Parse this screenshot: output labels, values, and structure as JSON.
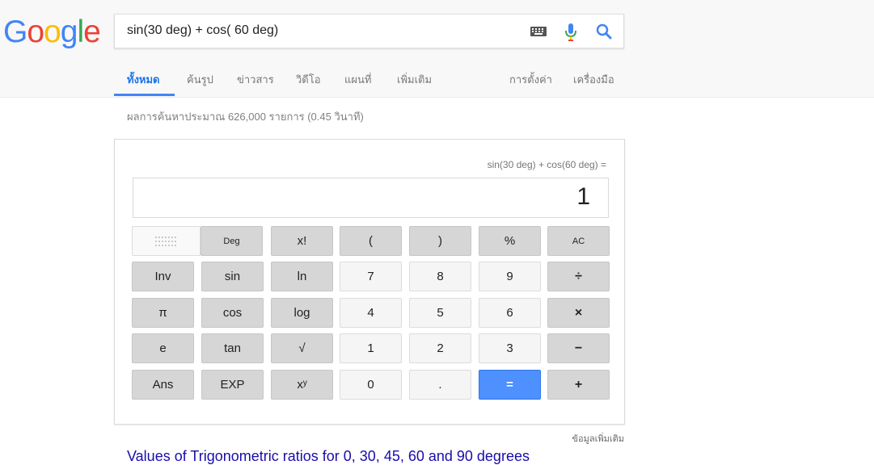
{
  "logo": {
    "letters": [
      "G",
      "o",
      "o",
      "g",
      "l",
      "e"
    ],
    "colors": [
      "#4285f4",
      "#ea4335",
      "#fbbc05",
      "#4285f4",
      "#34a853",
      "#ea4335"
    ]
  },
  "search": {
    "query": "sin(30 deg) + cos( 60 deg)"
  },
  "tabs": {
    "all": "ทั้งหมด",
    "images": "ค้นรูป",
    "news": "ข่าวสาร",
    "videos": "วิดีโอ",
    "maps": "แผนที่",
    "more": "เพิ่มเติม",
    "settings": "การตั้งค่า",
    "tools": "เครื่องมือ"
  },
  "stats": "ผลการค้นหาประมาณ 626,000 รายการ (0.45 วินาที)",
  "calculator": {
    "expression": "sin(30 deg) + cos(60 deg) =",
    "result": "1",
    "keys": {
      "deg": "Deg",
      "fact": "x!",
      "lparen": "(",
      "rparen": ")",
      "pct": "%",
      "ac": "AC",
      "inv": "Inv",
      "sin": "sin",
      "ln": "ln",
      "k7": "7",
      "k8": "8",
      "k9": "9",
      "div": "÷",
      "pi": "π",
      "cos": "cos",
      "log": "log",
      "k4": "4",
      "k5": "5",
      "k6": "6",
      "mul": "×",
      "e": "e",
      "tan": "tan",
      "sqrt": "√",
      "k1": "1",
      "k2": "2",
      "k3": "3",
      "sub": "−",
      "ans": "Ans",
      "exp": "EXP",
      "pow": "xʸ",
      "k0": "0",
      "dot": ".",
      "eq": "=",
      "add": "+"
    },
    "more_info": "ข้อมูลเพิ่มเติม"
  },
  "result_link": "Values of Trigonometric ratios for 0, 30, 45, 60 and 90 degrees"
}
